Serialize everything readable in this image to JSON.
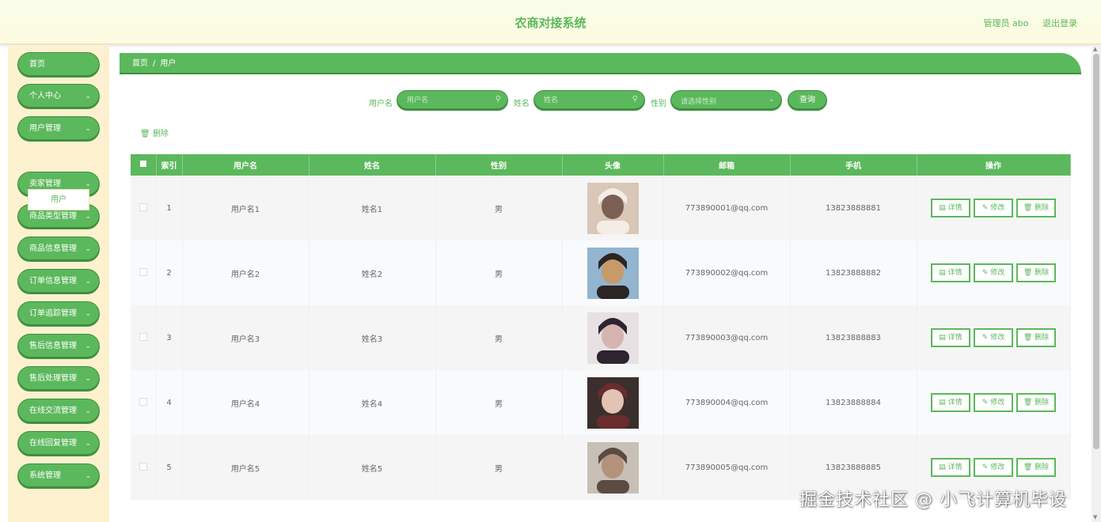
{
  "header": {
    "title": "农商对接系统",
    "user_label": "管理员 abo",
    "logout": "退出登录"
  },
  "sidebar": {
    "items": [
      {
        "label": "首页",
        "chevron": false
      },
      {
        "label": "个人中心",
        "chevron": true
      },
      {
        "label": "用户管理",
        "chevron": true
      },
      {
        "label": "卖家管理",
        "chevron": true
      },
      {
        "label": "商品类型管理",
        "chevron": true
      },
      {
        "label": "商品信息管理",
        "chevron": true
      },
      {
        "label": "订单信息管理",
        "chevron": true
      },
      {
        "label": "订单追踪管理",
        "chevron": true
      },
      {
        "label": "售后信息管理",
        "chevron": true
      },
      {
        "label": "售后处理管理",
        "chevron": true
      },
      {
        "label": "在线交流管理",
        "chevron": true
      },
      {
        "label": "在线回复管理",
        "chevron": true
      },
      {
        "label": "系统管理",
        "chevron": true
      }
    ],
    "submenu": {
      "label": "用户"
    }
  },
  "breadcrumb": {
    "home": "首页",
    "separator": "/",
    "current": "用户"
  },
  "search": {
    "username_label": "用户名",
    "username_placeholder": "用户名",
    "name_label": "姓名",
    "name_placeholder": "姓名",
    "gender_label": "性别",
    "gender_placeholder": "请选择性别",
    "query_button": "查询"
  },
  "toolbar": {
    "delete_label": "删除"
  },
  "table": {
    "headers": {
      "index": "索引",
      "username": "用户名",
      "name": "姓名",
      "gender": "性别",
      "avatar": "头像",
      "email": "邮箱",
      "phone": "手机",
      "actions": "操作"
    },
    "actions": {
      "detail": "详情",
      "edit": "修改",
      "delete": "删除"
    },
    "rows": [
      {
        "index": "1",
        "username": "用户名1",
        "name": "姓名1",
        "gender": "男",
        "email": "773890001@qq.com",
        "phone": "13823888881"
      },
      {
        "index": "2",
        "username": "用户名2",
        "name": "姓名2",
        "gender": "男",
        "email": "773890002@qq.com",
        "phone": "13823888882"
      },
      {
        "index": "3",
        "username": "用户名3",
        "name": "姓名3",
        "gender": "男",
        "email": "773890003@qq.com",
        "phone": "13823888883"
      },
      {
        "index": "4",
        "username": "用户名4",
        "name": "姓名4",
        "gender": "男",
        "email": "773890004@qq.com",
        "phone": "13823888884"
      },
      {
        "index": "5",
        "username": "用户名5",
        "name": "姓名5",
        "gender": "男",
        "email": "773890005@qq.com",
        "phone": "13823888885"
      }
    ]
  },
  "watermark": "掘金技术社区 @ 小飞计算机毕设",
  "colors": {
    "primary": "#5cb85c",
    "primary_dark": "#3e8f3e",
    "sidebar_bg": "#fdf1cf",
    "header_bg": "#fdfbe0"
  },
  "icons": {
    "search_input_icon": "search-icon",
    "select_icon": "chevron-down-icon",
    "delete_icon": "trash-icon",
    "detail_icon": "document-icon",
    "edit_icon": "pencil-icon"
  }
}
